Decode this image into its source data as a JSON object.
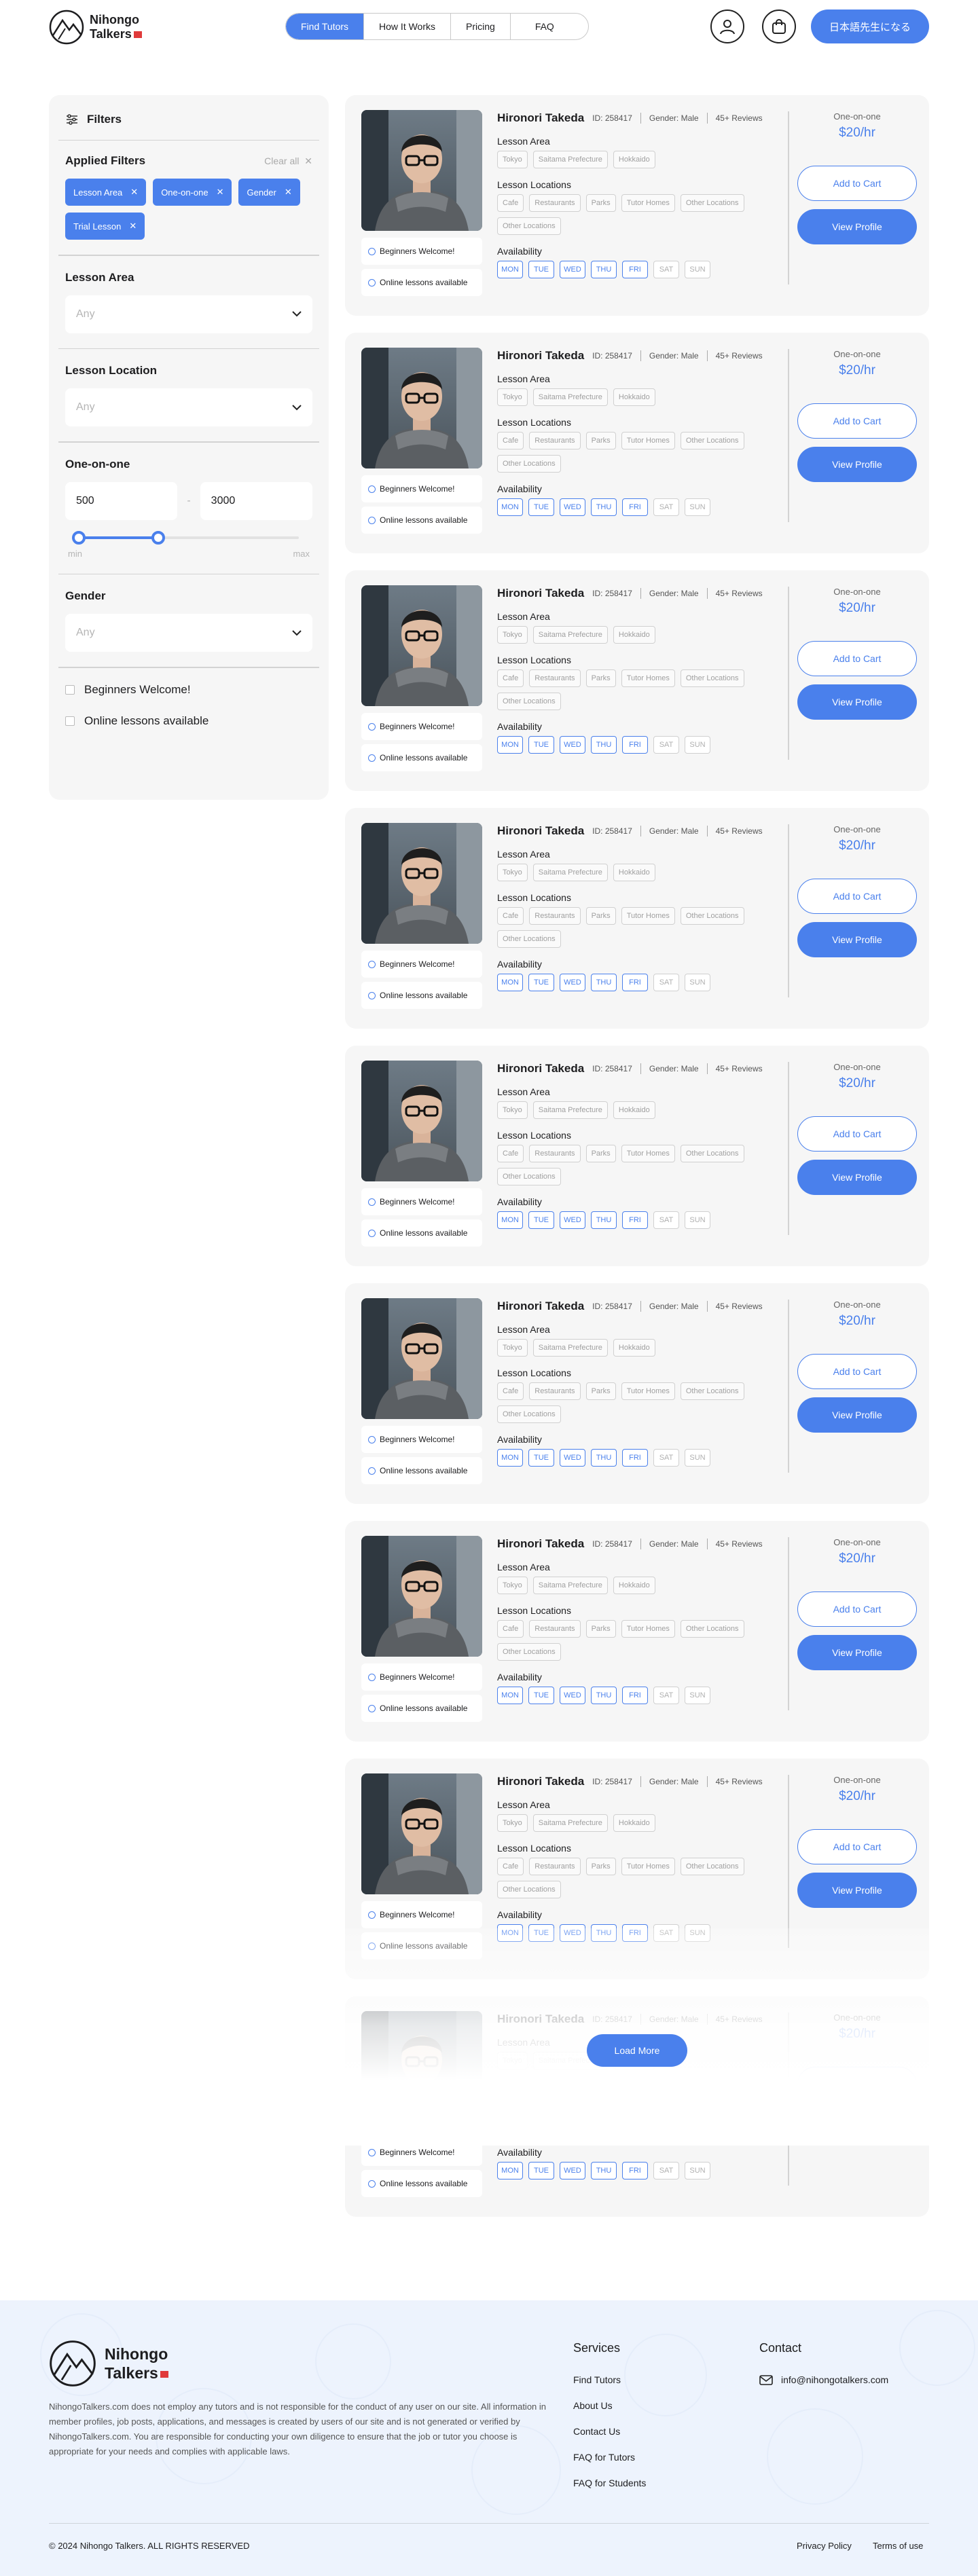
{
  "header": {
    "logo_line1": "Nihongo",
    "logo_line2": "Talkers",
    "nav": [
      "Find Tutors",
      "How It Works",
      "Pricing",
      "FAQ"
    ],
    "jp_button": "日本語先生になる",
    "icons": [
      "user-icon",
      "cart-icon"
    ]
  },
  "filters": {
    "title": "Filters",
    "applied_title": "Applied Filters",
    "clear_all": "Clear all",
    "chips": [
      "Lesson Area",
      "One-on-one",
      "Gender",
      "Trial Lesson"
    ],
    "lesson_area": {
      "label": "Lesson Area",
      "value": "Any"
    },
    "lesson_location": {
      "label": "Lesson Location",
      "value": "Any"
    },
    "one_on_one": {
      "label": "One-on-one",
      "min": "500",
      "max": "3000",
      "dash": "-",
      "min_label": "min",
      "max_label": "max",
      "range_start": 0,
      "range_end": 0.36
    },
    "gender": {
      "label": "Gender",
      "value": "Any"
    },
    "checks": [
      "Beginners Welcome!",
      "Online lessons available"
    ]
  },
  "tutor": {
    "name": "Hironori Takeda",
    "id": "ID: 258417",
    "gender": "Gender: Male",
    "reviews": "45+ Reviews",
    "area_label": "Lesson Area",
    "areas": [
      "Tokyo",
      "Saitama Prefecture",
      "Hokkaido"
    ],
    "locations_label": "Lesson Locations",
    "locations": [
      "Cafe",
      "Restaurants",
      "Parks",
      "Tutor Homes",
      "Other Locations",
      "Other Locations"
    ],
    "availability_label": "Availability",
    "days": [
      {
        "d": "MON",
        "on": true
      },
      {
        "d": "TUE",
        "on": true
      },
      {
        "d": "WED",
        "on": true
      },
      {
        "d": "THU",
        "on": true
      },
      {
        "d": "FRI",
        "on": true
      },
      {
        "d": "SAT",
        "on": false
      },
      {
        "d": "SUN",
        "on": false
      }
    ],
    "tag_beginners": "Beginners Welcome!",
    "tag_online": "Online lessons available",
    "price_label": "One-on-one",
    "price": "$20/hr",
    "add_to_cart": "Add to Cart",
    "view_profile": "View Profile"
  },
  "load_more": "Load More",
  "footer": {
    "logo_line1": "Nihongo",
    "logo_line2": "Talkers",
    "disclaimer": "NihongoTalkers.com does not employ any tutors and is not responsible for the conduct of any user on our site. All information in member profiles, job posts, applications, and messages is created by users of our site and is not generated or verified by NihongoTalkers.com. You are responsible for conducting your own diligence to ensure that the job or tutor you choose is appropriate for your needs and complies with applicable laws.",
    "services_title": "Services",
    "services": [
      "Find Tutors",
      "About Us",
      "Contact Us",
      "FAQ for Tutors",
      "FAQ for Students"
    ],
    "contact_title": "Contact",
    "email": "info@nihongotalkers.com",
    "copyright": "© 2024 Nihongo Talkers. ALL RIGHTS RESERVED",
    "privacy": "Privacy Policy",
    "terms": "Terms of use"
  },
  "colors": {
    "accent": "#4a80ec",
    "panel": "#f6f6f6",
    "footer_bg": "#edf3fd"
  }
}
